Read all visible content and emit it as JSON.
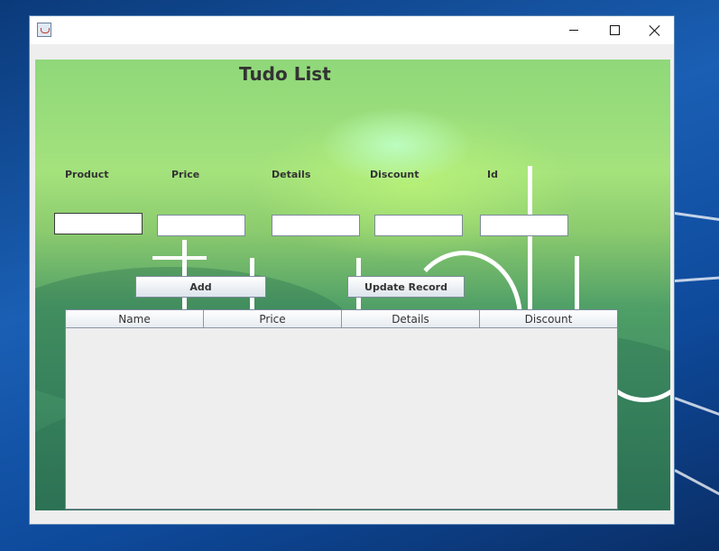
{
  "window": {
    "title": ""
  },
  "app": {
    "title": "Tudo List"
  },
  "form": {
    "labels": [
      "Product",
      "Price",
      "Details",
      "Discount",
      "Id"
    ],
    "fields": [
      {
        "value": "",
        "placeholder": ""
      },
      {
        "value": "",
        "placeholder": ""
      },
      {
        "value": "",
        "placeholder": ""
      },
      {
        "value": "",
        "placeholder": ""
      },
      {
        "value": "",
        "placeholder": ""
      }
    ]
  },
  "buttons": {
    "add": "Add",
    "update": "Update Record"
  },
  "table": {
    "columns": [
      "Name",
      "Price",
      "Details",
      "Discount"
    ],
    "rows": []
  },
  "icons": [
    "java-app-icon",
    "minimize-icon",
    "maximize-icon",
    "close-icon"
  ]
}
